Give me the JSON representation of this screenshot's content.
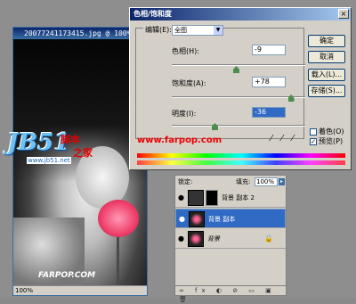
{
  "document": {
    "title": "20077241173415.jpg @ 100%",
    "status": "100%",
    "photo_watermark": "FARPOP.COM"
  },
  "dialog": {
    "title": "色相/饱和度",
    "close": "×",
    "edit_label": "编辑(E):",
    "edit_value": "全图",
    "hue_label": "色相(H):",
    "hue_value": "-9",
    "hue_level": 0.48,
    "sat_label": "饱和度(A):",
    "sat_value": "+78",
    "sat_level": 0.89,
    "light_label": "明度(I):",
    "light_value": "-36",
    "light_level": 0.32,
    "buttons": {
      "ok": "确定",
      "cancel": "取消",
      "load": "载入(L)...",
      "save": "存储(S)..."
    },
    "colorize_label": "着色(O)",
    "colorize_checked": false,
    "preview_label": "预览(P)",
    "preview_checked": true,
    "url_text": "www.farpop.com"
  },
  "layers": {
    "lock_label": "锁定:",
    "fill_label": "填充:",
    "fill_value": "100%",
    "rows": [
      {
        "name": "背景 副本 2",
        "selected": false
      },
      {
        "name": "背景 副本",
        "selected": true
      },
      {
        "name": "背景",
        "selected": false,
        "locked": true
      }
    ]
  },
  "logo": {
    "mark": "JB51",
    "cn_line1": "脚本",
    "cn_line2": "之家",
    "site": "www.jb51.net"
  },
  "colors": {
    "titlebar": "#0a246a",
    "selected_row": "#316ac5",
    "url_red": "#e00000"
  }
}
